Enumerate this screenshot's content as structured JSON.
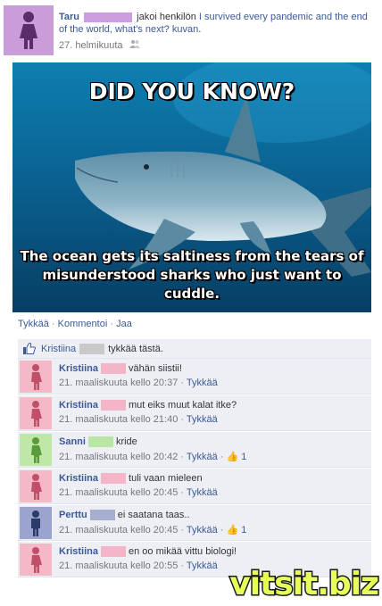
{
  "post": {
    "author": "Taru",
    "author_blur_color": "#cc9ee0",
    "text_before": "jakoi henkilön",
    "link_text": "I survived every pandemic and the end of the world, what's next?",
    "text_after": "kuvan.",
    "link_text2": "kuvan",
    "date": "27. helmikuuta",
    "privacy_icon": "friends-icon",
    "avatar_color": "#c99ed8"
  },
  "image": {
    "headline": "DID YOU KNOW?",
    "caption": "The ocean gets its saltiness from the tears of misunderstood sharks who just want to cuddle."
  },
  "actions": {
    "like": "Tykkää",
    "comment": "Kommentoi",
    "share": "Jaa",
    "sep": "·"
  },
  "likes": {
    "name": "Kristiina",
    "text": "tykkää tästä."
  },
  "comments": [
    {
      "name": "Kristiina",
      "blur": "#f5b5c8",
      "avatar": "#f4b8c6",
      "figure": "#c0506a",
      "text": "vähän siistii!",
      "time": "21. maaliskuuta kello 20:37",
      "like": "Tykkää",
      "likes": ""
    },
    {
      "name": "Kristiina",
      "blur": "#f5b5c8",
      "avatar": "#f4b8c6",
      "figure": "#c0506a",
      "text": "mut eiks muut kalat itke?",
      "time": "21. maaliskuuta kello 21:40",
      "like": "Tykkää",
      "likes": ""
    },
    {
      "name": "Sanni",
      "blur": "#b9e6a5",
      "avatar": "#bfe8a8",
      "figure": "#5a9a3c",
      "text": "kride",
      "time": "21. maaliskuuta kello 20:42",
      "like": "Tykkää",
      "likes": "1"
    },
    {
      "name": "Kristiina",
      "blur": "#f5b5c8",
      "avatar": "#f4b8c6",
      "figure": "#c0506a",
      "text": "tuli vaan mieleen",
      "time": "21. maaliskuuta kello 20:45",
      "like": "Tykkää",
      "likes": ""
    },
    {
      "name": "Perttu",
      "blur": "#a7afd0",
      "avatar": "#9aa4cc",
      "figure": "#2a3a6a",
      "text": "ei saatana taas..",
      "time": "21. maaliskuuta kello 20:45",
      "like": "Tykkää",
      "likes": "1"
    },
    {
      "name": "Kristiina",
      "blur": "#f5b5c8",
      "avatar": "#f4b8c6",
      "figure": "#c0506a",
      "text": "en oo mikää vittu biologi!",
      "time": "21. maaliskuuta kello 20:55",
      "like": "Tykkää",
      "likes": ""
    }
  ],
  "watermark": "vitsit.biz"
}
